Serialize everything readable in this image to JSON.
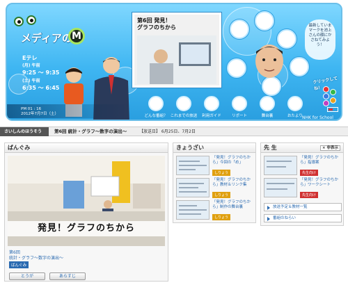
{
  "header": {
    "logo_text": "メディアの",
    "logo_letter": "M",
    "channel": "Eテレ",
    "schedule": [
      {
        "day": "(月) 午前",
        "time": "9:25 ～ 9:35"
      },
      {
        "day": "(土) 午前",
        "time": "6:35 ～ 6:45"
      }
    ],
    "video_caption_line1": "第6回 発見！",
    "video_caption_line2": "グラフのちから",
    "tagline": "最新していまマークを池上さんの顔にかさねてみよう！",
    "quiz_label": "クリックしてね！",
    "datetime_line1": "PM 01 : 16",
    "datetime_line2": "2012年7月7日（土）",
    "nhk": "NHK for School",
    "nav": [
      {
        "label": "どんな番組？",
        "icon": "tv-icon"
      },
      {
        "label": "これまでの放送",
        "icon": "list-icon"
      },
      {
        "label": "利用ガイド",
        "icon": "guide-icon"
      },
      {
        "label": "リポート",
        "icon": "report-icon"
      },
      {
        "label": "舞台裏",
        "icon": "backstage-icon"
      },
      {
        "label": "おたより",
        "icon": "mail-icon"
      }
    ],
    "dot_colors": [
      "#e83333",
      "#33b84a",
      "#3a7ae0",
      "#e8a020",
      "#c040c0"
    ]
  },
  "titlebar": {
    "section": "さいしんのほうそう",
    "episode": "第6回 統計・グラフ～数字の演出～",
    "air_dates": "【放送日】 6月25日、7月2日"
  },
  "program": {
    "heading": "ばんぐみ",
    "caption": "発見！グラフのちから",
    "episode_no": "第6回",
    "episode_title": "統計・グラフ～数字の演出～",
    "tag": "ばんぐみ",
    "buttons": {
      "play": "とうが",
      "synopsis": "あらすじ"
    }
  },
  "materials": {
    "heading": "きょうざい",
    "items": [
      {
        "title": "「発見！グラフのちから」今回の「め」",
        "tag": "しりょう"
      },
      {
        "title": "「発見！グラフのちから」教材＆リンク集",
        "tag": "しりょう"
      },
      {
        "title": "「発見！グラフのちから」制作の舞台裏",
        "tag": "しりょう"
      }
    ]
  },
  "teacher": {
    "heading": "先 生",
    "print_label": "× 非表示",
    "items": [
      {
        "title": "「発見！グラフのちから」指導案",
        "tag": "先生向け"
      },
      {
        "title": "「発見！グラフのちから」ワークシート",
        "tag": "先生向け"
      }
    ],
    "links": [
      "放送予定＆教材一覧",
      "番組のねらい"
    ]
  }
}
